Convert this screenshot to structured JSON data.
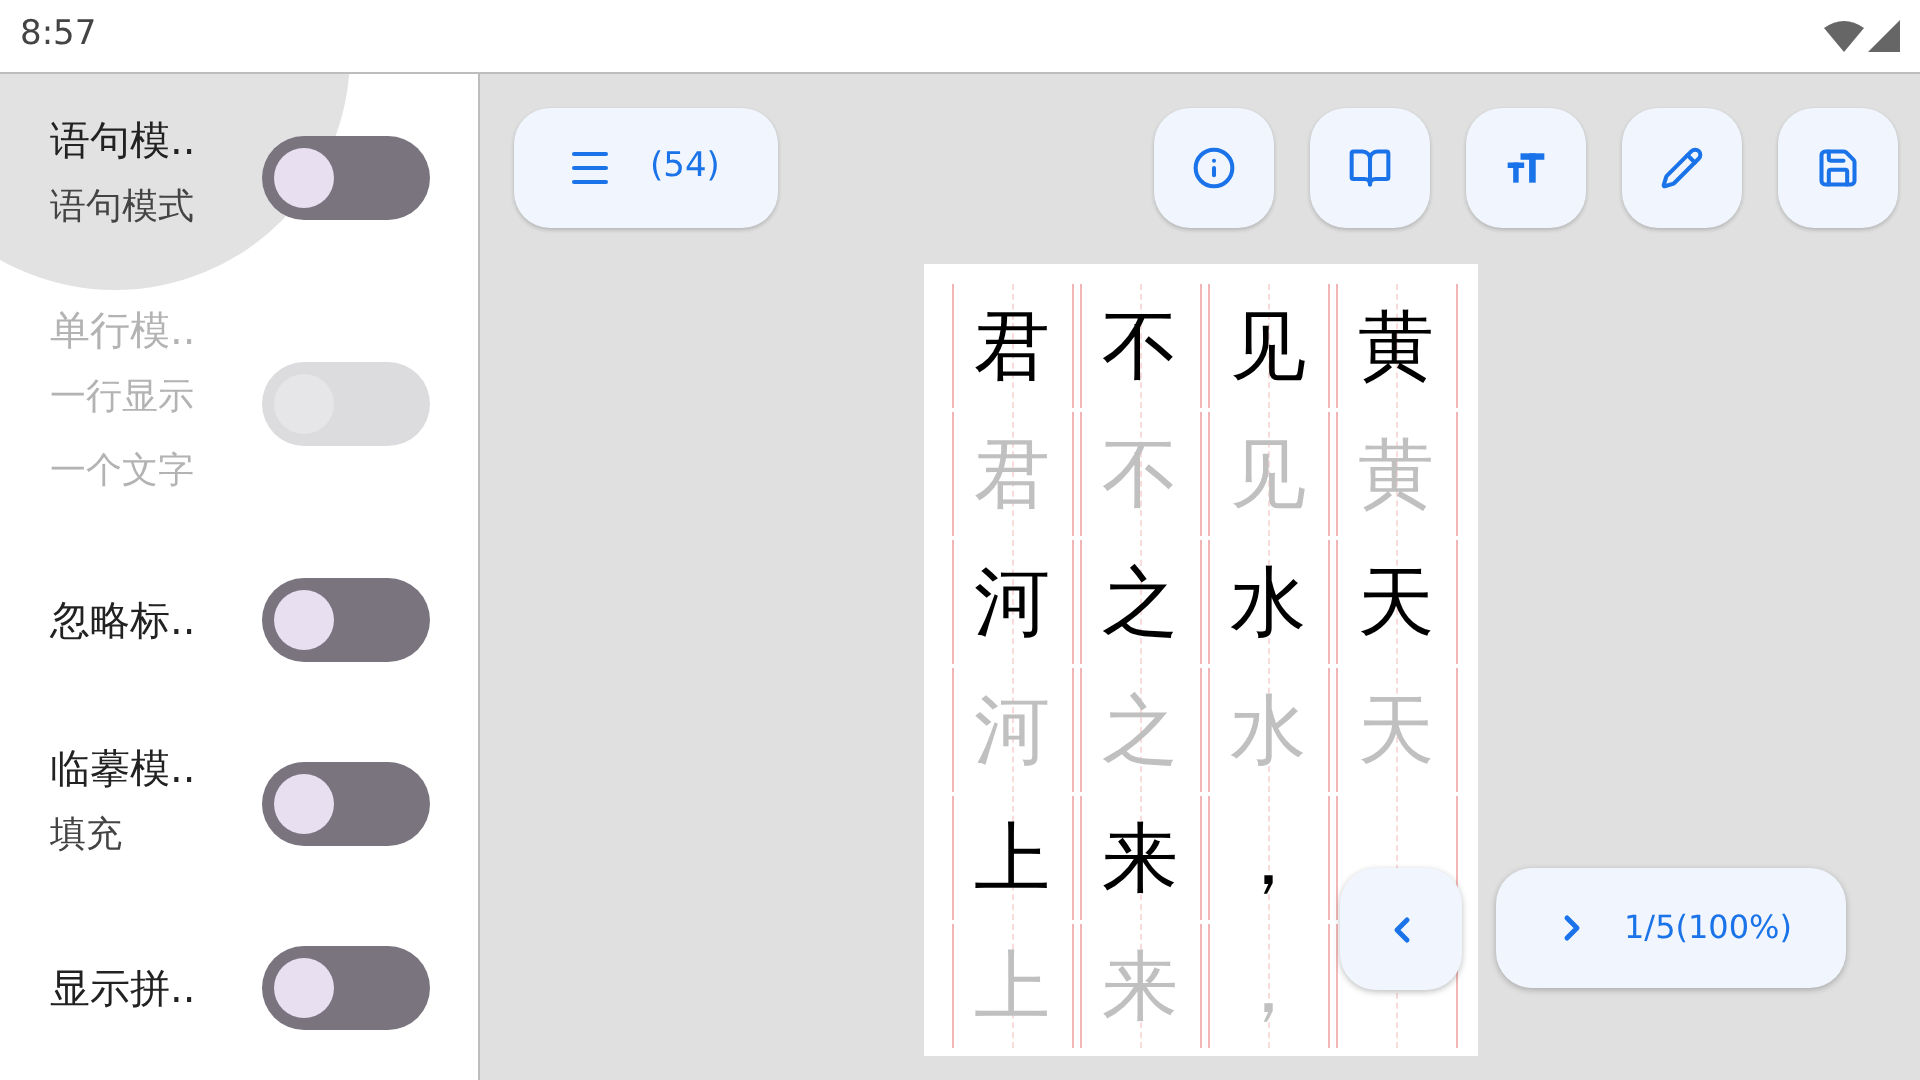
{
  "status_bar": {
    "time": "8:57"
  },
  "settings": [
    {
      "title": "语句模..",
      "subtitle": "语句模式",
      "on": false,
      "disabled": false,
      "pressed": true
    },
    {
      "title": "单行模..",
      "subtitle": "一行显示一个文字",
      "on": false,
      "disabled": true,
      "pressed": false
    },
    {
      "title": "忽略标..",
      "on": false,
      "disabled": false,
      "pressed": false
    },
    {
      "title": "临摹模..",
      "subtitle": "填充",
      "on": false,
      "disabled": false,
      "pressed": false
    },
    {
      "title": "显示拼..",
      "on": false,
      "disabled": false,
      "pressed": false
    }
  ],
  "toolbar": {
    "menu_count": "(54)",
    "tools": [
      {
        "kind": "info"
      },
      {
        "kind": "book"
      },
      {
        "kind": "text-size"
      },
      {
        "kind": "edit"
      },
      {
        "kind": "save"
      }
    ]
  },
  "grid": {
    "rows": [
      {
        "ghost": false,
        "chars": [
          "君",
          "不",
          "见",
          "黄"
        ]
      },
      {
        "ghost": true,
        "chars": [
          "君",
          "不",
          "见",
          "黄"
        ]
      },
      {
        "ghost": false,
        "chars": [
          "河",
          "之",
          "水",
          "天"
        ]
      },
      {
        "ghost": true,
        "chars": [
          "河",
          "之",
          "水",
          "天"
        ]
      },
      {
        "ghost": false,
        "chars": [
          "上",
          "来",
          "，"
        ]
      },
      {
        "ghost": true,
        "chars": [
          "上",
          "来",
          "，"
        ]
      }
    ]
  },
  "pager": {
    "label": "1/5(100%)"
  }
}
